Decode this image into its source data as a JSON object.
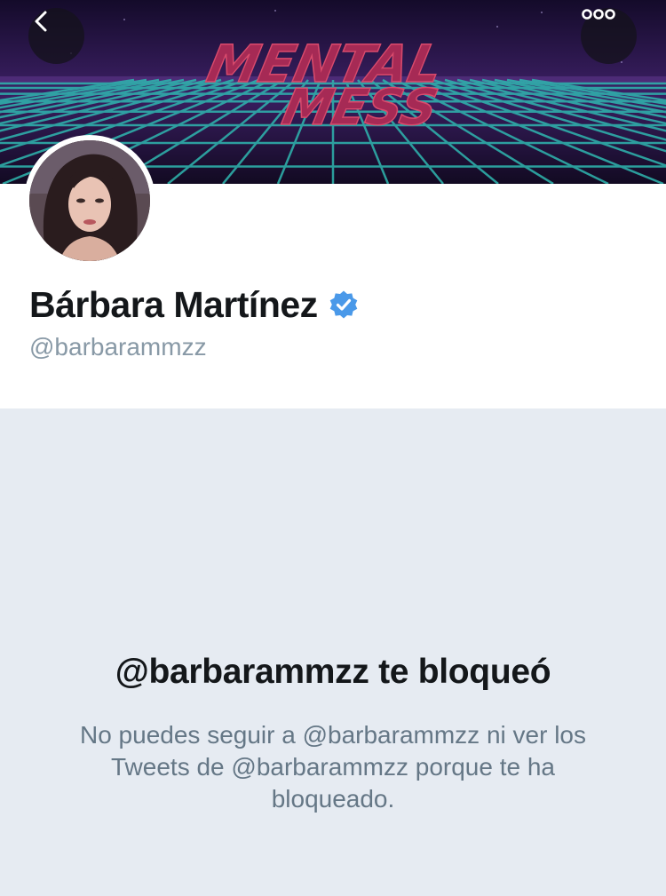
{
  "header": {
    "banner_text_line1": "MENTAL",
    "banner_text_line2": "MESS",
    "back_icon": "chevron-left-icon",
    "more_icon": "more-horizontal-icon"
  },
  "profile": {
    "name": "Bárbara Martínez",
    "handle": "@barbarammzz",
    "verified": true,
    "verified_color": "#4a99e9"
  },
  "blocked": {
    "title": "@barbarammzz te bloqueó",
    "message": "No puedes seguir a @barbarammzz ni ver los Tweets de @barbarammzz porque te ha bloqueado."
  },
  "colors": {
    "name_text": "#14171a",
    "secondary_text": "#8899a6",
    "message_text": "#657786",
    "blocked_background": "#e6ebf2"
  }
}
